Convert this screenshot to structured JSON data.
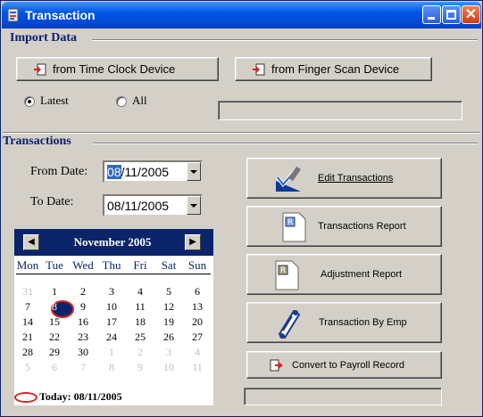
{
  "window": {
    "title": "Transaction"
  },
  "import": {
    "group_title": "Import Data",
    "time_clock_button": "from Time Clock Device",
    "finger_scan_button": "from Finger Scan Device",
    "radio_latest": "Latest",
    "radio_all": "All",
    "selected": "Latest"
  },
  "transactions": {
    "group_title": "Transactions",
    "from_label": "From Date:",
    "from_value_sel": "08",
    "from_value_rest": "/11/2005",
    "to_label": "To Date:",
    "to_value": "08/11/2005"
  },
  "calendar": {
    "month": "November 2005",
    "prev": "◀",
    "next": "▶",
    "dow": [
      "Mon",
      "Tue",
      "Wed",
      "Thu",
      "Fri",
      "Sat",
      "Sun"
    ],
    "weeks": [
      [
        "31",
        "1",
        "2",
        "3",
        "4",
        "5",
        "6"
      ],
      [
        "7",
        "8",
        "9",
        "10",
        "11",
        "12",
        "13"
      ],
      [
        "14",
        "15",
        "16",
        "17",
        "18",
        "19",
        "20"
      ],
      [
        "21",
        "22",
        "23",
        "24",
        "25",
        "26",
        "27"
      ],
      [
        "28",
        "29",
        "30",
        "1",
        "2",
        "3",
        "4"
      ],
      [
        "5",
        "6",
        "7",
        "8",
        "9",
        "10",
        "11"
      ]
    ],
    "today_label": "Today: 08/11/2005"
  },
  "actions": {
    "edit": "Edit Transactions",
    "report": "Transactions Report",
    "adjustment": "Adjustment Report",
    "by_emp": "Transaction By Emp",
    "convert": "Convert to Payroll Record"
  },
  "colors": {
    "accent": "#0a246a",
    "title_blue": "#0055e5",
    "highlight": "#316ac5",
    "circle": "#dd2222"
  }
}
